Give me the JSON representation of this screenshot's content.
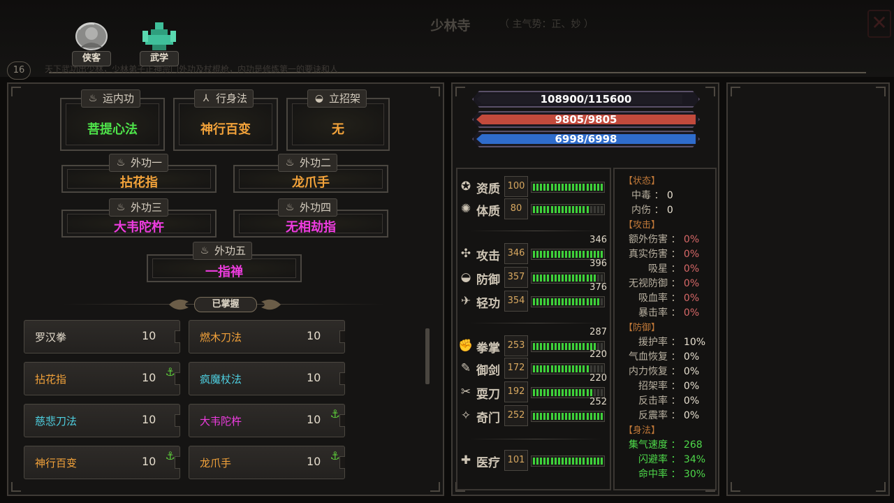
{
  "header": {
    "location": "少林寺",
    "location_note": "（ 主气势：正、妙 ）",
    "close_glyph": "✕",
    "level": "16",
    "faded_text": "天下武功出少林，少林弟子正神宗门外功及杖棍枪，内功是修炼第一的要诀和人"
  },
  "tabs": [
    {
      "label": "侠客",
      "icon": "portrait-icon"
    },
    {
      "label": "武学",
      "icon": "martial-arts-icon"
    }
  ],
  "equipped": {
    "inner": {
      "label": "运内功",
      "value": "菩提心法",
      "color": "#4ee44a"
    },
    "movement": {
      "label": "行身法",
      "value": "神行百变",
      "color": "#f2a23a"
    },
    "stance": {
      "label": "立招架",
      "value": "无",
      "color": "#f2a23a"
    },
    "outer1": {
      "label": "外功一",
      "value": "拈花指",
      "color": "#f2a23a"
    },
    "outer2": {
      "label": "外功二",
      "value": "龙爪手",
      "color": "#f2a23a"
    },
    "outer3": {
      "label": "外功三",
      "value": "大韦陀杵",
      "color": "#ee3ce0"
    },
    "outer4": {
      "label": "外功四",
      "value": "无相劫指",
      "color": "#ee3ce0"
    },
    "outer5": {
      "label": "外功五",
      "value": "一指禅",
      "color": "#ee3ce0"
    }
  },
  "owned_label": "已掌握",
  "skills": [
    {
      "name": "罗汉拳",
      "level": "10",
      "color": "#e4dccc",
      "anchor": false
    },
    {
      "name": "燃木刀法",
      "level": "10",
      "color": "#f2a23a",
      "anchor": false
    },
    {
      "name": "拈花指",
      "level": "10",
      "color": "#f2a23a",
      "anchor": true
    },
    {
      "name": "疯魔杖法",
      "level": "10",
      "color": "#4ecfe0",
      "anchor": false
    },
    {
      "name": "慈悲刀法",
      "level": "10",
      "color": "#4ecfe0",
      "anchor": false
    },
    {
      "name": "大韦陀杵",
      "level": "10",
      "color": "#ee3ce0",
      "anchor": true
    },
    {
      "name": "神行百变",
      "level": "10",
      "color": "#f2a23a",
      "anchor": true
    },
    {
      "name": "龙爪手",
      "level": "10",
      "color": "#f2a23a",
      "anchor": true
    }
  ],
  "anchor_glyph": "⚓",
  "bars": [
    {
      "text": "108900/115600",
      "current": 108900,
      "max": 115600,
      "color": "#1e1c24"
    },
    {
      "text": "9805/9805",
      "current": 9805,
      "max": 9805,
      "color": "#c24a3c"
    },
    {
      "text": "6998/6998",
      "current": 6998,
      "max": 6998,
      "color": "#2f6ccc"
    }
  ],
  "stats": [
    {
      "name": "资质",
      "value": "100",
      "cap": "",
      "icon": "talent-icon",
      "fill": 1.0
    },
    {
      "name": "体质",
      "value": "80",
      "cap": "",
      "icon": "constitution-icon",
      "fill": 0.8
    },
    {
      "name": "攻击",
      "value": "346",
      "cap": "346",
      "icon": "attack-icon",
      "fill": 1.0
    },
    {
      "name": "防御",
      "value": "357",
      "cap": "396",
      "icon": "defense-icon",
      "fill": 0.9
    },
    {
      "name": "轻功",
      "value": "354",
      "cap": "376",
      "icon": "lightness-icon",
      "fill": 0.94
    },
    {
      "name": "拳掌",
      "value": "253",
      "cap": "287",
      "icon": "fist-icon",
      "fill": 0.88
    },
    {
      "name": "御剑",
      "value": "172",
      "cap": "220",
      "icon": "sword-icon",
      "fill": 0.78
    },
    {
      "name": "耍刀",
      "value": "192",
      "cap": "220",
      "icon": "blade-icon",
      "fill": 0.87
    },
    {
      "name": "奇门",
      "value": "252",
      "cap": "252",
      "icon": "exotic-icon",
      "fill": 1.0
    },
    {
      "name": "医疗",
      "value": "101",
      "cap": "",
      "icon": "medical-icon",
      "fill": 1.0
    }
  ],
  "status": {
    "state_header": "【状态】",
    "state": [
      {
        "k": "中毒",
        "v": "0"
      },
      {
        "k": "内伤",
        "v": "0"
      }
    ],
    "attack_header": "【攻击】",
    "attack": [
      {
        "k": "额外伤害",
        "v": "0%"
      },
      {
        "k": "真实伤害",
        "v": "0%"
      },
      {
        "k": "吸星",
        "v": "0%"
      },
      {
        "k": "无视防御",
        "v": "0%"
      },
      {
        "k": "吸血率",
        "v": "0%"
      },
      {
        "k": "暴击率",
        "v": "0%"
      }
    ],
    "defense_header": "【防御】",
    "defense": [
      {
        "k": "援护率",
        "v": "10%"
      },
      {
        "k": "气血恢复",
        "v": "0%"
      },
      {
        "k": "内力恢复",
        "v": "0%"
      },
      {
        "k": "招架率",
        "v": "0%"
      },
      {
        "k": "反击率",
        "v": "0%"
      },
      {
        "k": "反震率",
        "v": "0%"
      }
    ],
    "body_header": "【身法】",
    "body": [
      {
        "k": "集气速度",
        "v": "268"
      },
      {
        "k": "闪避率",
        "v": "34%"
      },
      {
        "k": "命中率",
        "v": "30%"
      }
    ]
  }
}
